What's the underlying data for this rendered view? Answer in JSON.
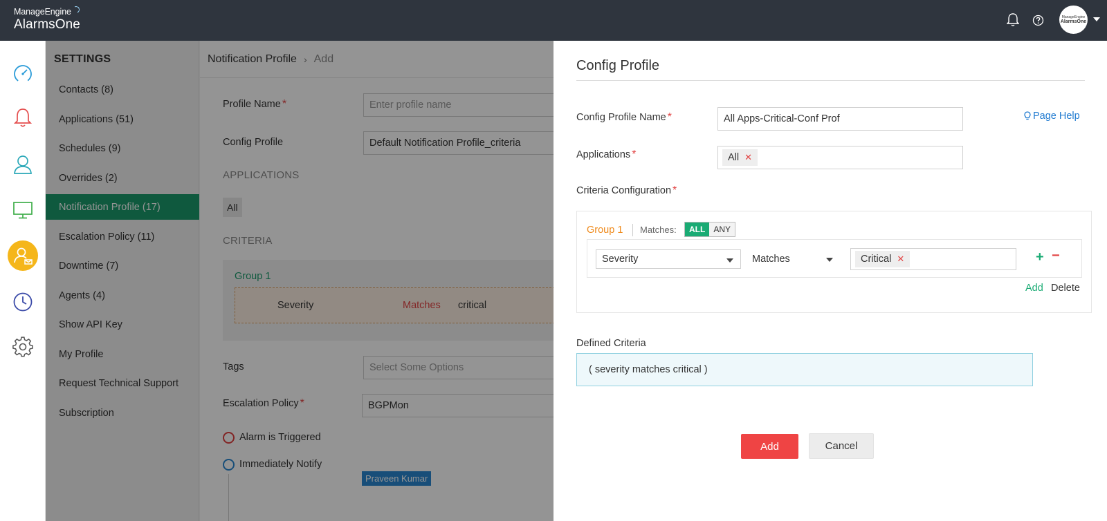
{
  "header": {
    "brand_top": "ManageEngine",
    "brand_name": "AlarmsOne",
    "avatar_line1": "ManageEngine",
    "avatar_line2": "AlarmsOne"
  },
  "rail": {
    "icons": [
      "dashboard-icon",
      "bell-icon",
      "user-icon",
      "monitor-icon",
      "user-settings-icon",
      "clock-icon",
      "gear-icon"
    ],
    "active": "user-settings-icon"
  },
  "settings": {
    "title": "SETTINGS",
    "items": [
      {
        "label": "Contacts (8)"
      },
      {
        "label": "Applications (51)"
      },
      {
        "label": "Schedules (9)"
      },
      {
        "label": "Overrides (2)"
      },
      {
        "label": "Notification Profile (17)"
      },
      {
        "label": "Escalation Policy (11)"
      },
      {
        "label": "Downtime (7)"
      },
      {
        "label": "Agents (4)"
      },
      {
        "label": "Show API Key"
      },
      {
        "label": "My Profile"
      },
      {
        "label": "Request Technical Support"
      },
      {
        "label": "Subscription"
      }
    ],
    "active_index": 4
  },
  "underlay": {
    "breadcrumb": [
      "Notification Profile",
      "Add"
    ],
    "profile_name_label": "Profile Name",
    "profile_name_placeholder": "Enter profile name",
    "config_profile_label": "Config Profile",
    "config_profile_value": "Default Notification Profile_criteria",
    "applications_heading": "APPLICATIONS",
    "applications_value": "All",
    "criteria_heading": "CRITERIA",
    "criteria_group": "Group 1",
    "criteria_field": "Severity",
    "criteria_op": "Matches",
    "criteria_value": "critical",
    "tags_label": "Tags",
    "tags_placeholder": "Select Some Options",
    "escalation_label": "Escalation Policy",
    "escalation_value": "BGPMon",
    "alarm_triggered": "Alarm is Triggered",
    "immediately_notify": "Immediately Notify",
    "notify_user": "Praveen Kumar"
  },
  "panel": {
    "title": "Config Profile",
    "page_help": "Page Help",
    "name_label": "Config Profile Name",
    "name_value": "All Apps-Critical-Conf Prof",
    "applications_label": "Applications",
    "applications_tag": "All",
    "criteria_label": "Criteria Configuration",
    "group_title": "Group 1",
    "matches_label": "Matches:",
    "match_all": "ALL",
    "match_any": "ANY",
    "rule_field": "Severity",
    "rule_op": "Matches",
    "rule_value": "Critical",
    "add_link": "Add",
    "delete_link": "Delete",
    "defined_label": "Defined Criteria",
    "defined_value": "( severity matches critical )",
    "add_button": "Add",
    "cancel_button": "Cancel"
  },
  "colors": {
    "topbar": "#2f353e",
    "active_green": "#1a9a6b",
    "accent_orange": "#f5b61a",
    "danger": "#ef4444"
  }
}
